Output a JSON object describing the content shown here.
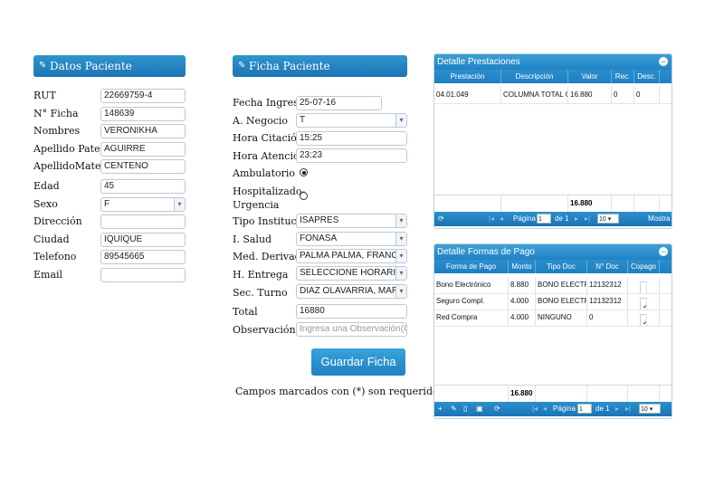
{
  "datos_paciente": {
    "title": "Datos Paciente",
    "fields": [
      {
        "label": "RUT",
        "value": "22669759-4"
      },
      {
        "label": "N° Ficha",
        "value": "148639"
      },
      {
        "label": "Nombres",
        "value": "VERONIKHA"
      },
      {
        "label": "Apellido Paterno",
        "value": "AGUIRRE"
      },
      {
        "label": "ApellidoMaterno",
        "value": "CENTENO"
      },
      {
        "label": "Edad",
        "value": "45"
      },
      {
        "label": "Sexo",
        "value": "F"
      },
      {
        "label": "Dirección",
        "value": ""
      },
      {
        "label": "Ciudad",
        "value": "IQUIQUE"
      },
      {
        "label": "Telefono",
        "value": "89545665"
      },
      {
        "label": "Email",
        "value": ""
      }
    ]
  },
  "ficha_paciente": {
    "title": "Ficha Paciente",
    "fecha_ingreso": {
      "label": "Fecha Ingreso",
      "value": "25-07-16"
    },
    "a_negocio": {
      "label": "A. Negocio",
      "value": "T"
    },
    "hora_citacion": {
      "label": "Hora Citación",
      "value": "15:25"
    },
    "hora_atencion": {
      "label": "Hora Atención",
      "value": "23:23"
    },
    "ambulatorio": {
      "label": "Ambulatorio",
      "checked": true
    },
    "hospitalizado": {
      "label1": "Hospitalizado-",
      "label2": "Urgencia",
      "checked": false
    },
    "tipo_institucion": {
      "label": "Tipo Institución",
      "value": "ISAPRES"
    },
    "i_salud": {
      "label": "I. Salud",
      "value": "FONASA"
    },
    "med_derivador": {
      "label": "Med. Derivador",
      "value": "PALMA PALMA, FRANCISCO"
    },
    "h_entrega": {
      "label": "H. Entrega",
      "value": "SELECCIONE HORARIO"
    },
    "sec_turno": {
      "label": "Sec. Turno",
      "value": "DIAZ OLAVARRIA, MARCELO"
    },
    "total": {
      "label": "Total",
      "value": "16880"
    },
    "observacion": {
      "label": "Observación",
      "placeholder": "Ingresa una Observación(Opcional)"
    },
    "save_label": "Guardar Ficha",
    "required_note": "Campos marcados con (*) son requeridos"
  },
  "detalle_prestaciones": {
    "title": "Detalle Prestaciones",
    "collapse_icon": "−",
    "columns": [
      "Prestación",
      "Descripción",
      "Valor",
      "Rec.",
      "Desc."
    ],
    "rows": [
      {
        "prestacion": "04.01.049",
        "descripcion": "COLUMNA TOTAL O",
        "valor": "16.880",
        "rec": "0",
        "desc": "0"
      }
    ],
    "total": "16.880",
    "pager": {
      "page_label": "Página",
      "page_value": "1",
      "of_label": "de 1",
      "size": "10",
      "extra": "Mostra"
    }
  },
  "formas_pago": {
    "title": "Detalle Formas de Pago",
    "collapse_icon": "−",
    "columns": [
      "Forma de Pago",
      "Monto",
      "Tipo Doc",
      "N° Doc",
      "Copago"
    ],
    "rows": [
      {
        "forma": "Bono Electrónico",
        "monto": "8.880",
        "tipo": "BONO ELECTRO",
        "numero": "12132312",
        "copago": false
      },
      {
        "forma": "Seguro Compl.",
        "monto": "4.000",
        "tipo": "BONO ELECTRO",
        "numero": "12132312",
        "copago": true
      },
      {
        "forma": "Red Compra",
        "monto": "4.000",
        "tipo": "NINGUNO",
        "numero": "0",
        "copago": true
      }
    ],
    "total": "16.880",
    "pager": {
      "page_label": "Página",
      "page_value": "1",
      "of_label": "de 1",
      "size": "10"
    }
  },
  "colors": {
    "accent": "#1f82c4",
    "header_gradient_top": "#2f95cf"
  },
  "icons": {
    "edit": "pencil-icon",
    "add": "plus-icon",
    "delete": "trash-icon",
    "refresh": "refresh-icon",
    "copy": "document-icon"
  }
}
